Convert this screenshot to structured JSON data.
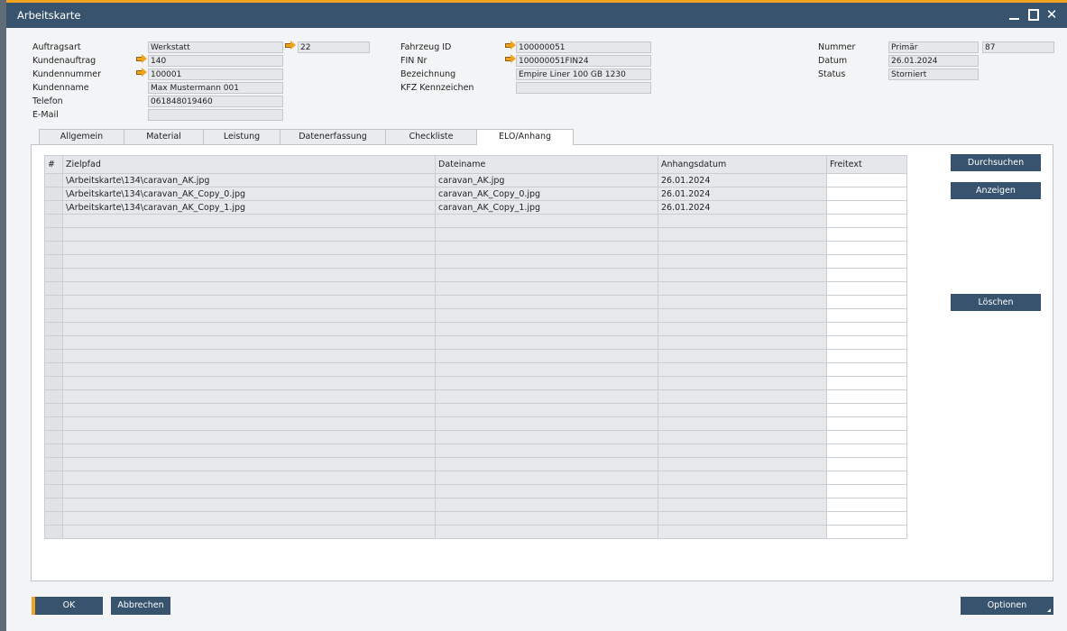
{
  "window": {
    "title": "Arbeitskarte"
  },
  "header": {
    "left": [
      {
        "label": "Auftragsart",
        "value": "Werkstatt",
        "extra": "22"
      },
      {
        "label": "Kundenauftrag",
        "value": "140"
      },
      {
        "label": "Kundennummer",
        "value": "100001"
      },
      {
        "label": "Kundenname",
        "value": "Max Mustermann 001"
      },
      {
        "label": "Telefon",
        "value": "061848019460"
      },
      {
        "label": "E-Mail",
        "value": ""
      }
    ],
    "middle": [
      {
        "label": "Fahrzeug ID",
        "value": "100000051"
      },
      {
        "label": "FIN Nr",
        "value": "100000051FIN24"
      },
      {
        "label": "Bezeichnung",
        "value": "Empire Liner 100 GB 1230"
      },
      {
        "label": "KFZ Kennzeichen",
        "value": ""
      }
    ],
    "right": [
      {
        "label": "Nummer",
        "value": "Primär",
        "extra": "87"
      },
      {
        "label": "Datum",
        "value": "26.01.2024"
      },
      {
        "label": "Status",
        "value": "Storniert"
      }
    ]
  },
  "tabs": [
    "Allgemein",
    "Material",
    "Leistung",
    "Datenerfassung",
    "Checkliste",
    "ELO/Anhang"
  ],
  "active_tab": "ELO/Anhang",
  "grid": {
    "columns": [
      "#",
      "Zielpfad",
      "Dateiname",
      "Anhangsdatum",
      "Freitext"
    ],
    "rows": [
      {
        "num": "",
        "path": "\\Arbeitskarte\\134\\caravan_AK.jpg",
        "file": "caravan_AK.jpg",
        "date": "26.01.2024",
        "free": ""
      },
      {
        "num": "",
        "path": "\\Arbeitskarte\\134\\caravan_AK_Copy_0.jpg",
        "file": "caravan_AK_Copy_0.jpg",
        "date": "26.01.2024",
        "free": ""
      },
      {
        "num": "",
        "path": "\\Arbeitskarte\\134\\caravan_AK_Copy_1.jpg",
        "file": "caravan_AK_Copy_1.jpg",
        "date": "26.01.2024",
        "free": ""
      }
    ]
  },
  "side_buttons": {
    "browse": "Durchsuchen",
    "show": "Anzeigen",
    "delete": "Löschen"
  },
  "footer": {
    "ok": "OK",
    "cancel": "Abbrechen",
    "options": "Optionen"
  },
  "colors": {
    "accent": "#f2a31d",
    "button": "#38536d",
    "titlebar": "#38536d"
  }
}
